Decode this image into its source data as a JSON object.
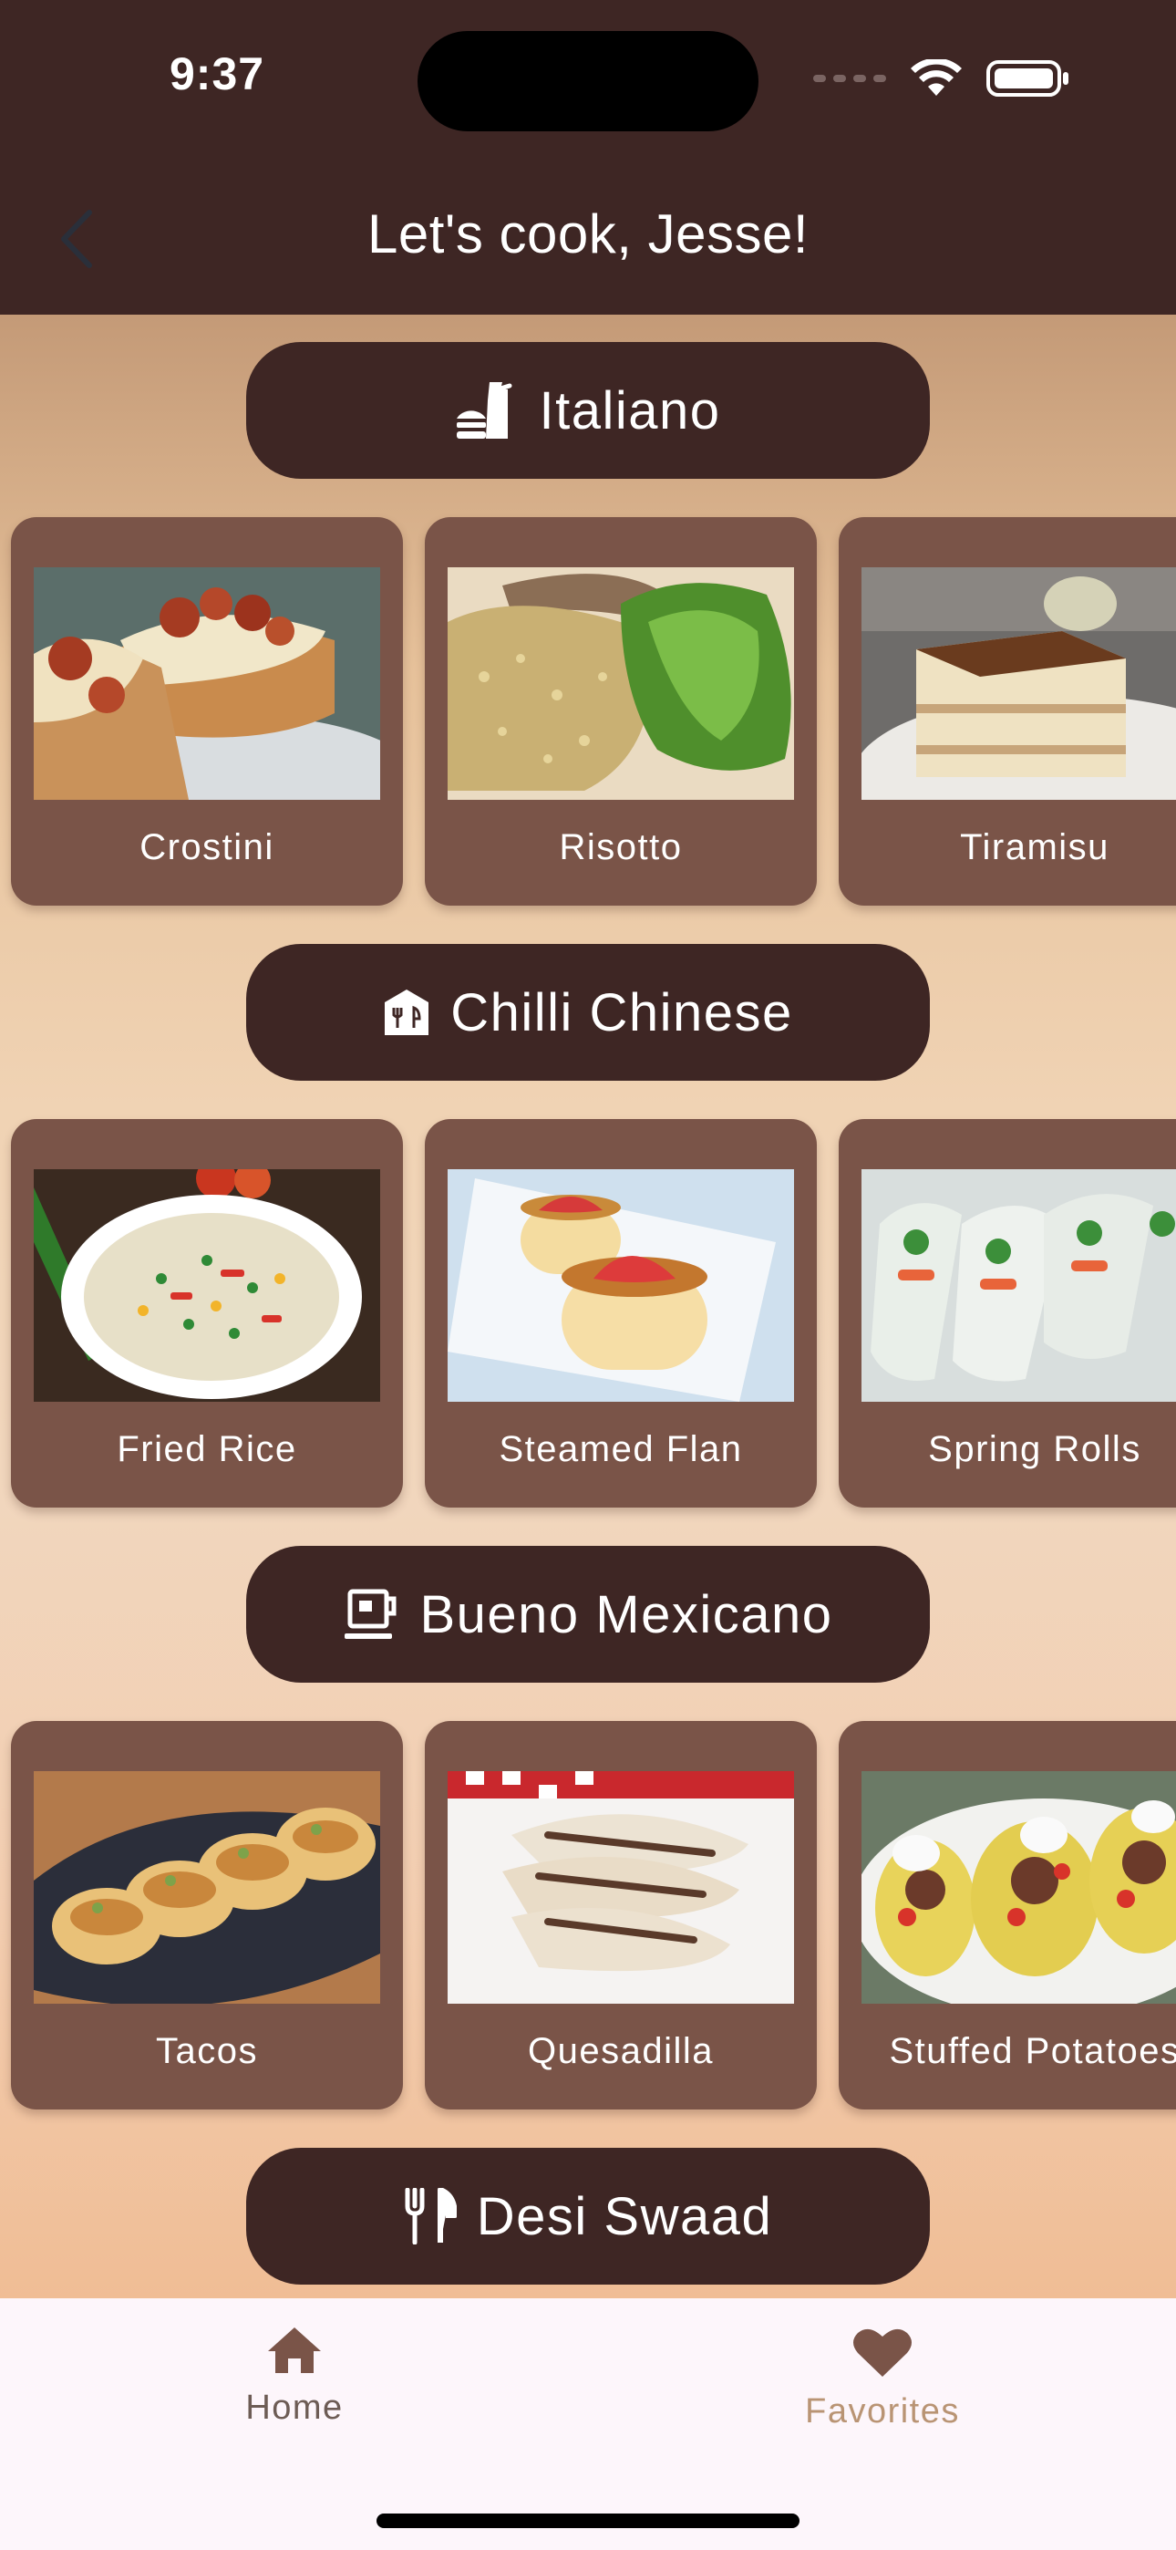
{
  "status_bar": {
    "time": "9:37"
  },
  "header": {
    "title": "Let's cook, Jesse!"
  },
  "sections": [
    {
      "title": "Italiano",
      "icon": "food-bag-icon",
      "dishes": [
        {
          "name": "Crostini"
        },
        {
          "name": "Risotto"
        },
        {
          "name": "Tiramisu"
        }
      ]
    },
    {
      "title": "Chilli Chinese",
      "icon": "restaurant-house-icon",
      "dishes": [
        {
          "name": "Fried Rice"
        },
        {
          "name": "Steamed Flan"
        },
        {
          "name": "Spring Rolls"
        }
      ]
    },
    {
      "title": "Bueno Mexicano",
      "icon": "coffee-cup-icon",
      "dishes": [
        {
          "name": "Tacos"
        },
        {
          "name": "Quesadilla"
        },
        {
          "name": "Stuffed Potatoes"
        }
      ]
    },
    {
      "title": "Desi Swaad",
      "icon": "fork-knife-icon",
      "dishes": []
    }
  ],
  "tab_bar": {
    "home": {
      "label": "Home",
      "icon": "home-icon",
      "color": "#7a5448"
    },
    "favorites": {
      "label": "Favorites",
      "icon": "heart-icon",
      "color": "#b99474"
    }
  },
  "colors": {
    "header_bg": "#3e2624",
    "pill_bg": "#3e2624",
    "card_bg": "#7a5448"
  }
}
